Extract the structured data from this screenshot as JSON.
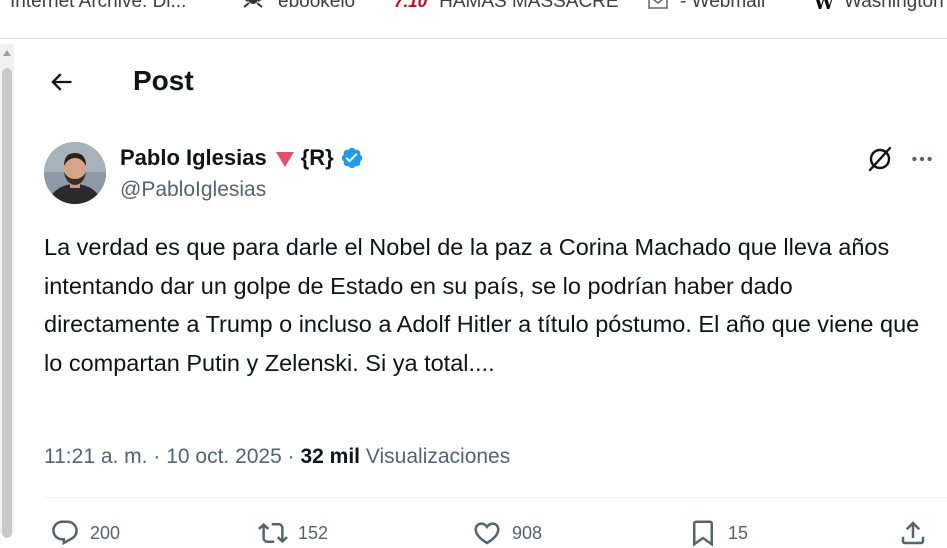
{
  "bookmarks_bar": {
    "items": [
      {
        "label": "Internet Archive: Di...",
        "icon": "archive-icon"
      },
      {
        "label": "ebookelo",
        "icon": "ebookelo-icon"
      },
      {
        "label": "HAMAS MASSACRE",
        "icon": "seven-ten-badge",
        "badge": "7.10"
      },
      {
        "label": "- Webmail",
        "icon": "mail-icon"
      },
      {
        "label": "Washington",
        "icon": "washington-post-icon"
      }
    ]
  },
  "header": {
    "title": "Post",
    "back_icon": "arrow-left-icon"
  },
  "post": {
    "author": {
      "name": "Pablo Iglesias",
      "tag": "{R}",
      "handle": "@PabloIglesias",
      "verified": true,
      "verified_color": "#1d9bf0",
      "triangle_color": "#e2506c"
    },
    "text": "La verdad es que para darle el Nobel de la paz a Corina Machado que lleva años intentando dar un golpe de Estado en su país, se lo podrían haber dado directamente a Trump o incluso a Adolf Hitler a título póstumo. El año que viene que lo compartan Putin y Zelenski. Si ya total....",
    "time": "11:21 a. m.",
    "date": "10 oct. 2025",
    "separator": "·",
    "views_count": "32 mil",
    "views_label": "Visualizaciones"
  },
  "actions": {
    "reply": {
      "icon": "reply-icon",
      "count": "200"
    },
    "repost": {
      "icon": "repost-icon",
      "count": "152"
    },
    "like": {
      "icon": "heart-icon",
      "count": "908"
    },
    "bookmark": {
      "icon": "bookmark-icon",
      "count": "15"
    },
    "share": {
      "icon": "share-icon"
    }
  },
  "colors": {
    "text_primary": "#0f1419",
    "text_secondary": "#536471",
    "accent": "#1d9bf0"
  }
}
